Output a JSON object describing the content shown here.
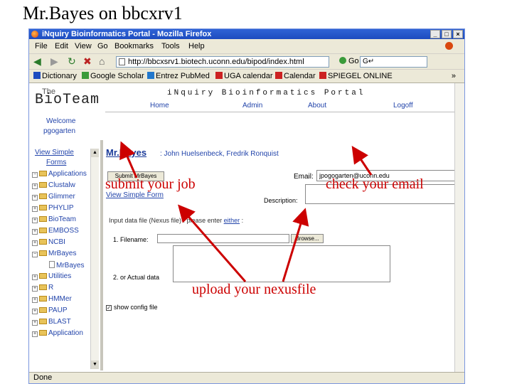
{
  "slide_title": "Mr.Bayes on bbcxrv1",
  "window": {
    "title": "iNquiry Bioinformatics Portal - Mozilla Firefox",
    "buttons": [
      "_",
      "□",
      "×"
    ]
  },
  "menu": [
    "File",
    "Edit",
    "View",
    "Go",
    "Bookmarks",
    "Tools",
    "Help"
  ],
  "nav": {
    "url": "http://bbcxsrv1.biotech.uconn.edu/bipod/index.html",
    "go_label": "Go",
    "search_value": "G↵"
  },
  "bookmarks": [
    {
      "label": "Dictionary",
      "color": "#1d4cbf"
    },
    {
      "label": "Google Scholar",
      "color": "#3a9b3a"
    },
    {
      "label": "Entrez PubMed",
      "color": "#2277cc"
    },
    {
      "label": "UGA calendar",
      "color": "#cc2222"
    },
    {
      "label": "Calendar",
      "color": "#cc2222"
    },
    {
      "label": "SPIEGEL ONLINE",
      "color": "#cc2222"
    }
  ],
  "bookmarks_more": "»",
  "page": {
    "logo_the": "The",
    "logo_bio": "BioTeam",
    "portal_title": "iNquiry   Bioinformatics   Portal",
    "nav": [
      "Home",
      "Admin",
      "About",
      "Logoff"
    ],
    "welcome": "Welcome",
    "user": "pgogarten",
    "program_title": "Mr.Bayes",
    "authors": ": John Huelsenbeck, Fredrik Ronquist",
    "submit_label": "Submit MrBayes",
    "email_label": "Email:",
    "email_value": "jpogogarten@uconn.edu",
    "simple_form_link": "View Simple Form",
    "description_label": "Description:",
    "input_note_prefix": "Input data file (Nexus file) :",
    "input_note_mid": "please enter ",
    "input_note_link": "either",
    "input_note_suffix": " :",
    "filename_label": "1. Filename:",
    "browse_label": "Browse...",
    "data_label": "2. or Actual data",
    "show_config_label": "show config file"
  },
  "sidebar": {
    "view_simple": "View Simple",
    "items": [
      "Forms",
      "Applications",
      "Clustalw",
      "Glimmer",
      "PHYLIP",
      "BioTeam",
      "EMBOSS",
      "NCBI",
      "MrBayes",
      "MrBayes",
      "Utilities",
      "R",
      "HMMer",
      "PAUP",
      "BLAST",
      "Application"
    ]
  },
  "status": "Done",
  "callouts": {
    "submit": "submit your job",
    "email": "check your email",
    "upload": "upload your nexusfile"
  },
  "colors": {
    "callout": "#cc0000",
    "titlebar": "#1d4cbf",
    "link": "#2244aa"
  }
}
